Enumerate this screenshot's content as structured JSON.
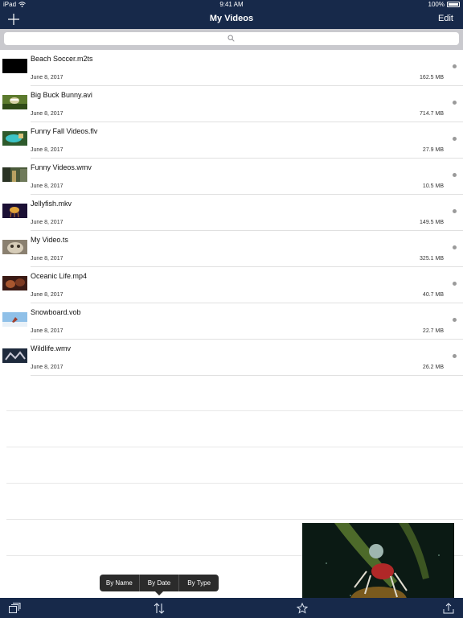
{
  "status_bar": {
    "device": "iPad",
    "time": "9:41 AM",
    "battery": "100%"
  },
  "nav": {
    "title": "My Videos",
    "edit_label": "Edit",
    "add_icon": "plus-icon"
  },
  "search": {
    "placeholder": "",
    "value": "",
    "icon": "search-icon"
  },
  "videos": [
    {
      "name": "Beach Soccer.m2ts",
      "date": "June 8, 2017",
      "size": "162.5 MB"
    },
    {
      "name": "Big Buck Bunny.avi",
      "date": "June 8, 2017",
      "size": "714.7 MB"
    },
    {
      "name": "Funny Fall Videos.flv",
      "date": "June 8, 2017",
      "size": "27.9 MB"
    },
    {
      "name": "Funny Videos.wmv",
      "date": "June 8, 2017",
      "size": "10.5 MB"
    },
    {
      "name": "Jellyfish.mkv",
      "date": "June 8, 2017",
      "size": "149.5 MB"
    },
    {
      "name": "My Video.ts",
      "date": "June 8, 2017",
      "size": "325.1 MB"
    },
    {
      "name": "Oceanic Life.mp4",
      "date": "June 8, 2017",
      "size": "40.7 MB"
    },
    {
      "name": "Snowboard.vob",
      "date": "June 8, 2017",
      "size": "22.7 MB"
    },
    {
      "name": "Wildlife.wmv",
      "date": "June 8, 2017",
      "size": "26.2 MB"
    }
  ],
  "sort_menu": {
    "options": [
      "By Name",
      "By Date",
      "By Type"
    ]
  },
  "toolbar": {
    "icons": [
      "playlist-icon",
      "sort-icon",
      "favorites-icon",
      "share-icon"
    ]
  },
  "colors": {
    "bar": "#17294a",
    "search_bg": "#c9c9ce",
    "popover": "#2b2b2b"
  }
}
